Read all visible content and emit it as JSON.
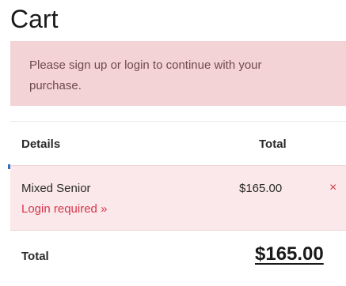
{
  "page": {
    "title": "Cart"
  },
  "alert": {
    "message": "Please sign up or login to continue with your purchase."
  },
  "table": {
    "headers": {
      "details": "Details",
      "total": "Total"
    },
    "items": [
      {
        "name": "Mixed Senior",
        "price": "$165.00",
        "status_link": "Login required »",
        "remove_icon": "×"
      }
    ],
    "footer": {
      "label": "Total",
      "value": "$165.00"
    }
  },
  "colors": {
    "alert_background": "#f3d3d6",
    "row_background": "#fbe8ea",
    "accent_red": "#d5364a"
  },
  "icons": {
    "remove": "close-icon"
  }
}
